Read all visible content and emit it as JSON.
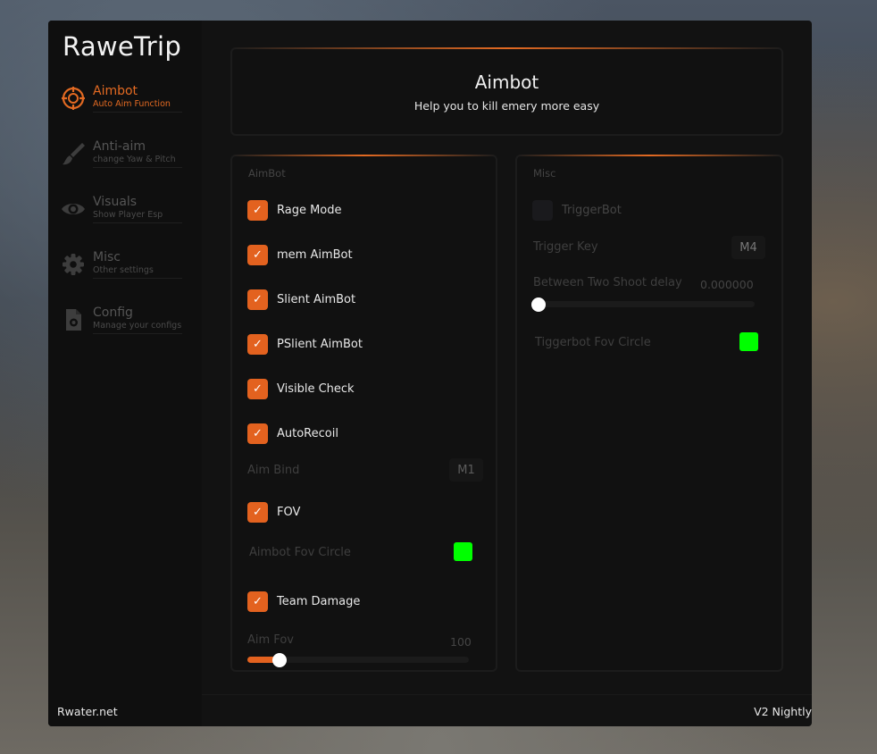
{
  "app": {
    "title": "RaweTrip",
    "footer_left": "Rwater.net",
    "footer_right": "V2 Nightly"
  },
  "sidebar": {
    "items": [
      {
        "label": "Aimbot",
        "sub": "Auto Aim Function",
        "icon": "crosshair-icon",
        "active": true
      },
      {
        "label": "Anti-aim",
        "sub": "change Yaw & Pitch",
        "icon": "brush-icon",
        "active": false
      },
      {
        "label": "Visuals",
        "sub": "Show Player Esp",
        "icon": "eye-icon",
        "active": false
      },
      {
        "label": "Misc",
        "sub": "Other settings",
        "icon": "gear-icon",
        "active": false
      },
      {
        "label": "Config",
        "sub": "Manage your configs",
        "icon": "config-file-icon",
        "active": false
      }
    ]
  },
  "header": {
    "title": "Aimbot",
    "subtitle": "Help you to kill emery more easy"
  },
  "aimbot_panel": {
    "title": "AimBot",
    "checks": [
      {
        "label": "Rage Mode",
        "checked": true
      },
      {
        "label": "mem AimBot",
        "checked": true
      },
      {
        "label": "Slient AimBot",
        "checked": true
      },
      {
        "label": "PSlient AimBot",
        "checked": true
      },
      {
        "label": "Visible Check",
        "checked": true
      },
      {
        "label": "AutoRecoil",
        "checked": true
      }
    ],
    "aim_bind_label": "Aim Bind",
    "aim_bind_key": "M1",
    "fov_label": "FOV",
    "fov_checked": true,
    "fov_circle_label": "Aimbot Fov Circle",
    "fov_circle_color": "#00ff00",
    "team_damage_label": "Team Damage",
    "team_damage_checked": true,
    "aim_fov_label": "Aim Fov",
    "aim_fov_value": "100",
    "aim_fov_fraction": 0.12
  },
  "misc_panel": {
    "title": "Misc",
    "triggerbot_label": "TriggerBot",
    "triggerbot_checked": false,
    "trigger_key_label": "Trigger Key",
    "trigger_key": "M4",
    "delay_label": "Between Two Shoot delay",
    "delay_value": "0.000000",
    "delay_fraction": 0,
    "fov_circle_label": "Tiggerbot Fov Circle",
    "fov_circle_color": "#00ff00"
  },
  "colors": {
    "accent": "#e3621f",
    "background": "#121212",
    "swatch_green": "#00ff00"
  }
}
